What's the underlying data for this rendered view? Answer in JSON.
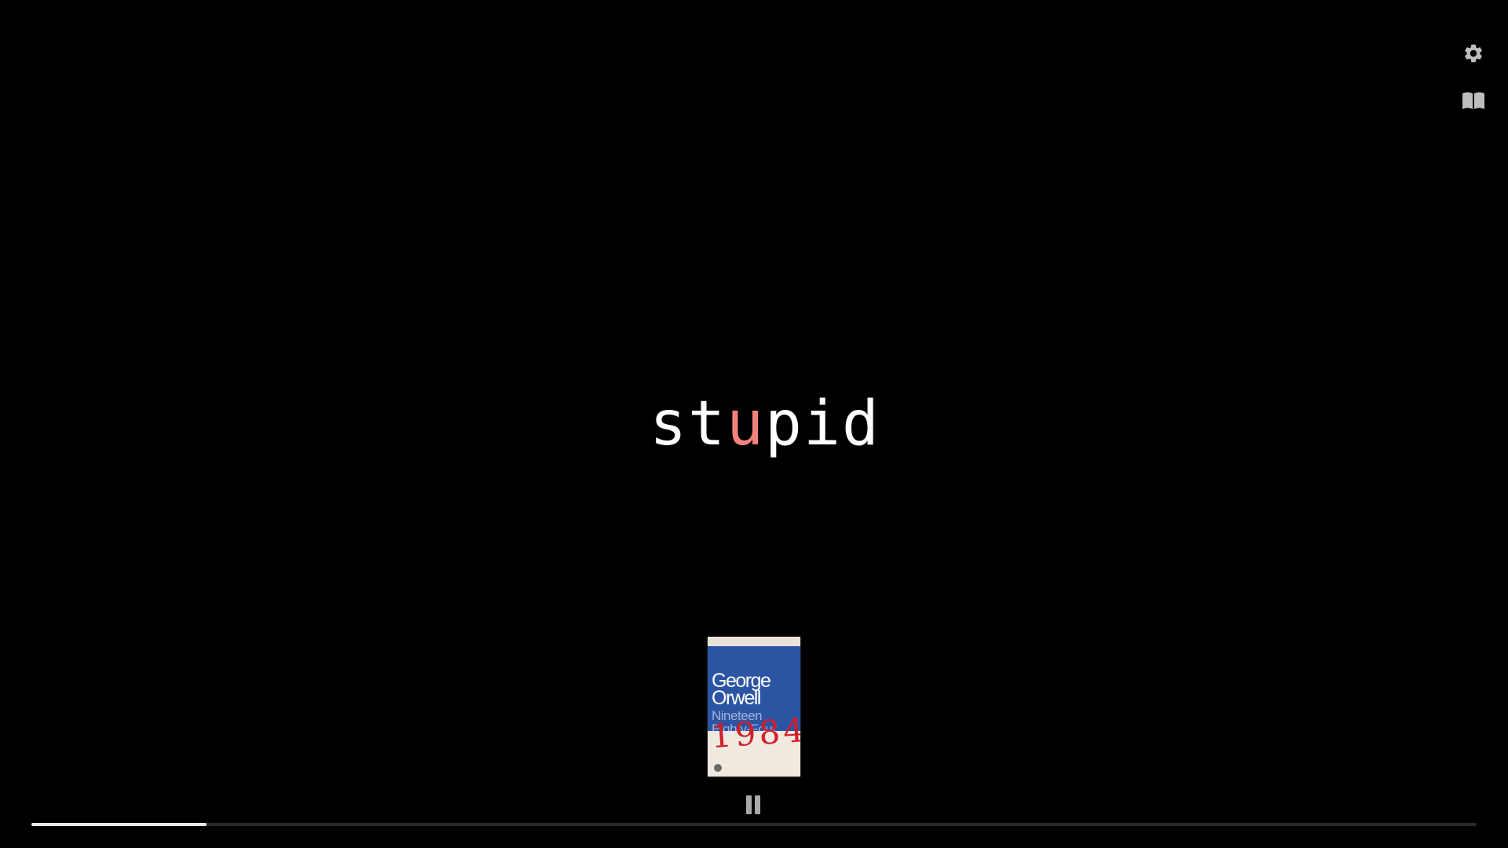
{
  "reader": {
    "word_before": "st",
    "focus_letter": "u",
    "word_after": "pid",
    "focus_color": "#f2837c"
  },
  "toolbar": {
    "settings_icon": "gear-icon",
    "library_icon": "open-book-icon"
  },
  "book": {
    "author": "George Orwell",
    "title": "Nineteen Eighty-Four",
    "scrawl": "1984"
  },
  "playback": {
    "state_icon": "pause-icon",
    "progress": 0.121
  }
}
